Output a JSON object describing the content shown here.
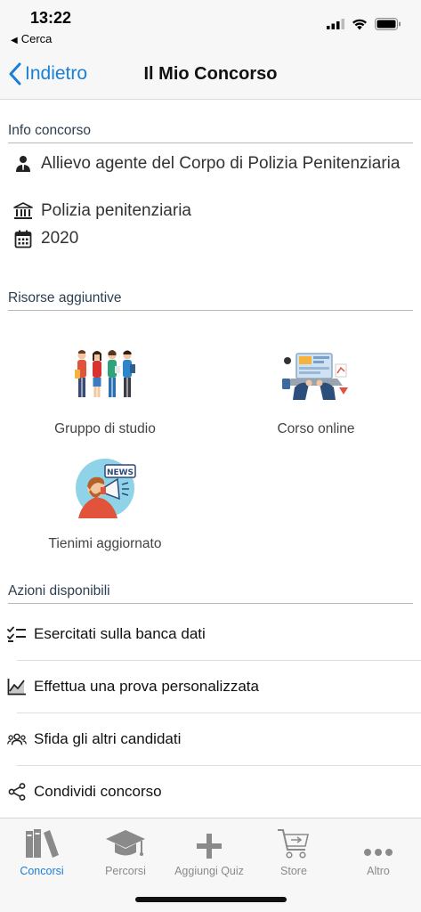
{
  "status": {
    "time": "13:22",
    "back_app": "Cerca"
  },
  "nav": {
    "back_label": "Indietro",
    "title": "Il Mio Concorso"
  },
  "info": {
    "header": "Info concorso",
    "name": "Allievo agente del Corpo di Polizia Penitenziaria",
    "organization": "Polizia penitenziaria",
    "year": "2020"
  },
  "resources": {
    "header": "Risorse aggiuntive",
    "items": [
      {
        "label": "Gruppo di studio"
      },
      {
        "label": "Corso online"
      },
      {
        "label": "Tienimi aggiornato",
        "badge": "NEWS"
      }
    ]
  },
  "actions": {
    "header": "Azioni disponibili",
    "items": [
      {
        "label": "Esercitati sulla banca dati",
        "icon": "checklist-icon"
      },
      {
        "label": "Effettua una prova personalizzata",
        "icon": "chart-icon"
      },
      {
        "label": "Sfida gli altri candidati",
        "icon": "group-icon"
      },
      {
        "label": "Condividi concorso",
        "icon": "share-icon"
      }
    ]
  },
  "tabs": [
    {
      "label": "Concorsi",
      "active": true
    },
    {
      "label": "Percorsi"
    },
    {
      "label": "Aggiungi Quiz"
    },
    {
      "label": "Store"
    },
    {
      "label": "Altro"
    }
  ],
  "colors": {
    "accent": "#1a7fd6",
    "header_text": "#2c3e50",
    "tab_inactive": "#8a8a8a"
  }
}
